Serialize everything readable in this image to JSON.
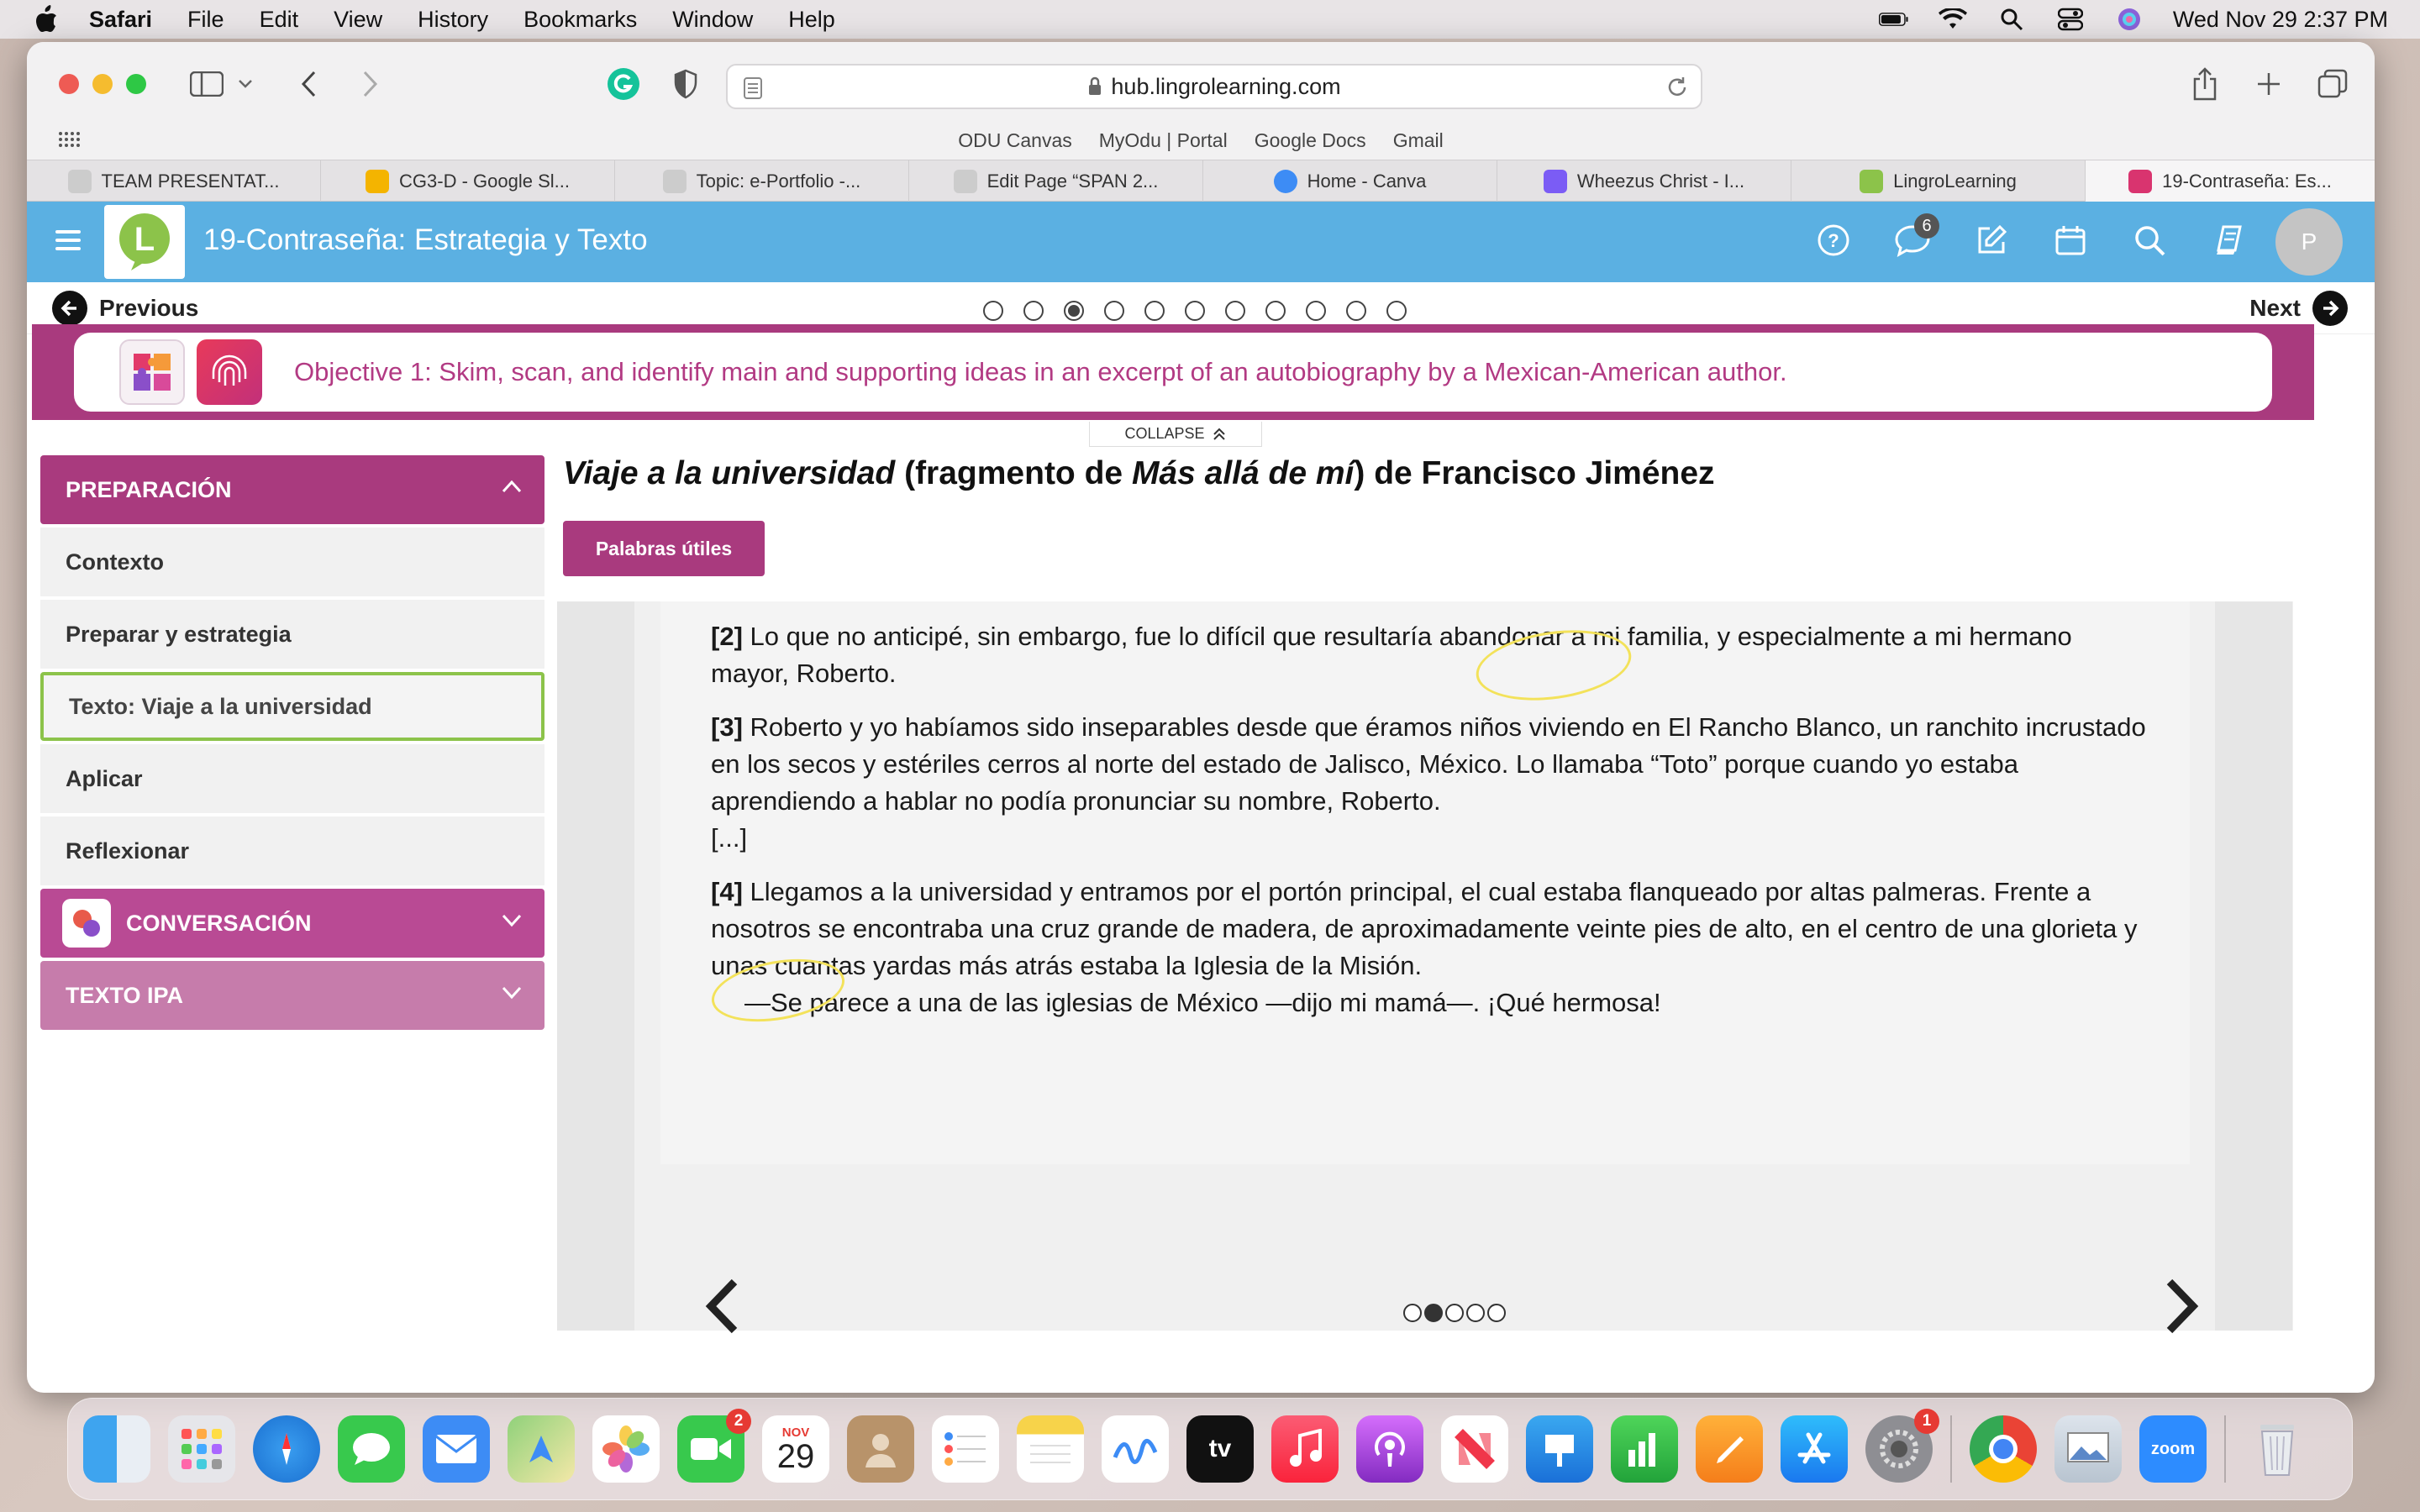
{
  "menubar": {
    "app": "Safari",
    "items": [
      "File",
      "Edit",
      "View",
      "History",
      "Bookmarks",
      "Window",
      "Help"
    ],
    "clock": "Wed Nov 29  2:37 PM"
  },
  "browser": {
    "url": "hub.lingrolearning.com",
    "favorites": [
      "ODU Canvas",
      "MyOdu | Portal",
      "Google Docs",
      "Gmail"
    ],
    "tabs": [
      {
        "label": "TEAM PRESENTAT...",
        "color": "#444"
      },
      {
        "label": "CG3-D - Google Sl...",
        "color": "#f4b400"
      },
      {
        "label": "Topic: e-Portfolio -...",
        "color": "#444"
      },
      {
        "label": "Edit Page “SPAN 2...",
        "color": "#444"
      },
      {
        "label": "Home - Canva",
        "color": "#3d8cf5"
      },
      {
        "label": "Wheezus Christ - I...",
        "color": "#7b5cf5"
      },
      {
        "label": "LingroLearning",
        "color": "#8cc34a"
      },
      {
        "label": "19-Contraseña: Es...",
        "color": "#d9346f"
      }
    ]
  },
  "site": {
    "title": "19-Contraseña: Estrategia y Texto",
    "messages_badge": "6",
    "avatar_initial": "P"
  },
  "pager": {
    "prev_label": "Previous",
    "next_label": "Next",
    "dots_total": 11,
    "dots_active_index": 2
  },
  "objective": {
    "text": "Objective 1: Skim, scan, and identify main and supporting ideas in an excerpt of an autobiography by a Mexican-American author.",
    "collapse_label": "COLLAPSE"
  },
  "sidebar": {
    "preparacion_label": "PREPARACIÓN",
    "items": [
      "Contexto",
      "Preparar y estrategia",
      "Texto: Viaje a la universidad",
      "Aplicar",
      "Reflexionar"
    ],
    "active_index": 2,
    "conversacion_label": "CONVERSACIÓN",
    "texto_ipa_label": "TEXTO IPA"
  },
  "content": {
    "title_part1": "Viaje a la universidad",
    "title_part2": " (fragmento de ",
    "title_part3": "Más allá de mí",
    "title_part4": ") de Francisco Jiménez",
    "palabras_button": "Palabras útiles",
    "p2_num": "[2]",
    "p2_text": " Lo que no anticipé, sin embargo, fue lo difícil que resultaría abandonar a mi familia, y especialmente a mi hermano mayor, Roberto.",
    "p3_num": "[3]",
    "p3_text": " Roberto y yo habíamos sido inseparables desde que éramos niños viviendo en El Rancho Blanco, un ranchito incrustado en los secos y estériles cerros al norte del estado de Jalisco, México. Lo llamaba “Toto” porque cuando yo estaba aprendiendo a hablar no podía pronunciar su nombre, Roberto.",
    "ellipsis": "[...]",
    "p4_num": "[4]",
    "p4_text": " Llegamos a la universidad y entramos por el portón principal, el cual estaba flanqueado por altas palmeras. Frente a nosotros se encontraba una cruz grande de madera, de aproximadamente veinte pies de alto, en el centro de una glorieta y unas cuantas yardas más atrás estaba la Iglesia de la Misión.",
    "dialogue": "—Se parece a una de las iglesias de México —dijo mi mamá—. ¡Qué hermosa!",
    "slide_dots_total": 5,
    "slide_dots_active_index": 1
  },
  "dock": {
    "calendar_month": "NOV",
    "calendar_day": "29",
    "facetime_badge": "2",
    "settings_badge": "1",
    "zoom_label": "zoom",
    "tv_label": "tv"
  },
  "colors": {
    "brand_blue": "#5bb0e2",
    "brand_magenta": "#a93a7e",
    "active_green": "#8cc34a",
    "highlight_yellow": "#f3e25a"
  }
}
